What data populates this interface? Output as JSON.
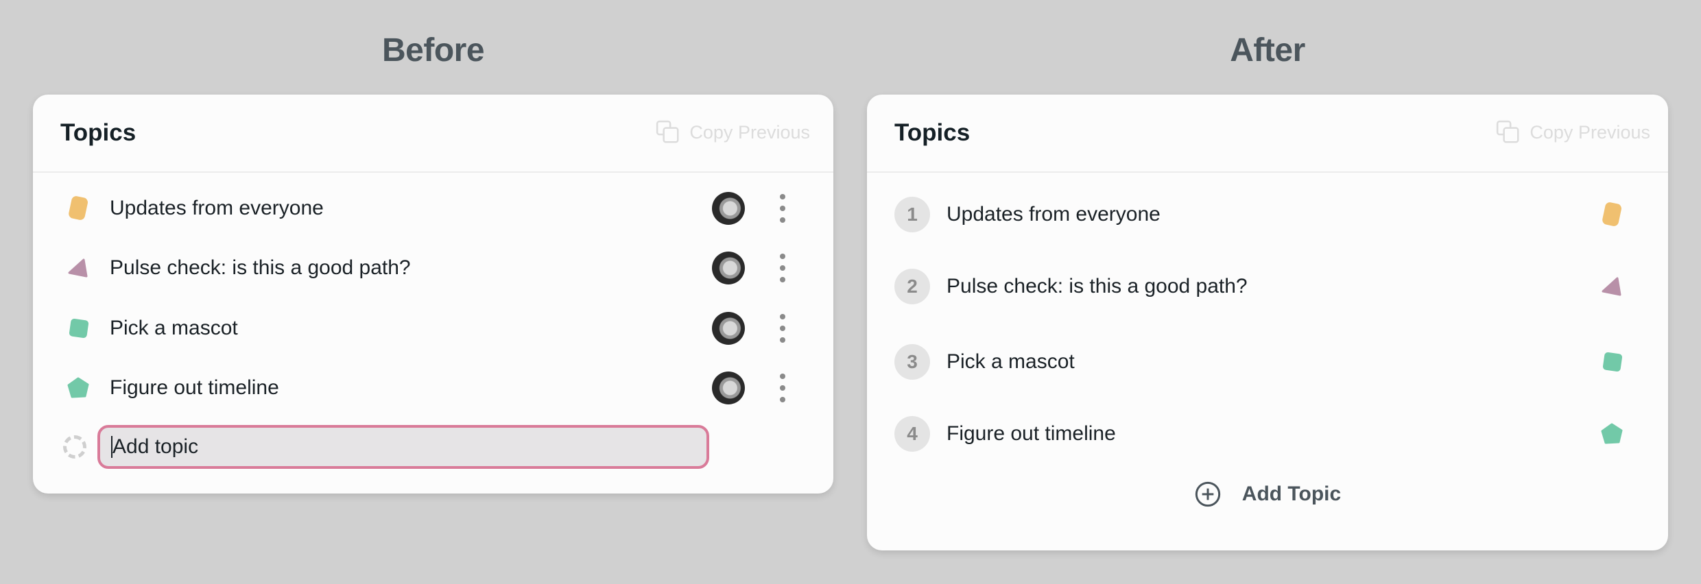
{
  "before": {
    "panel_title": "Before",
    "card": {
      "heading": "Topics",
      "copy_previous_label": "Copy Previous",
      "topics": [
        {
          "label": "Updates from everyone",
          "shape": "rounded-rectangle",
          "color": "#f0c070"
        },
        {
          "label": "Pulse check: is this a good path?",
          "shape": "triangle",
          "color": "#b890a8"
        },
        {
          "label": "Pick a mascot",
          "shape": "square",
          "color": "#72c9a8"
        },
        {
          "label": "Figure out timeline",
          "shape": "pentagon",
          "color": "#72c9a8"
        }
      ],
      "add_input": {
        "placeholder": "Add topic",
        "value": ""
      }
    }
  },
  "after": {
    "panel_title": "After",
    "card": {
      "heading": "Topics",
      "copy_previous_label": "Copy Previous",
      "topics": [
        {
          "number": "1",
          "label": "Updates from everyone",
          "shape": "rounded-rectangle",
          "color": "#f0c070"
        },
        {
          "number": "2",
          "label": "Pulse check: is this a good path?",
          "shape": "triangle",
          "color": "#b890a8"
        },
        {
          "number": "3",
          "label": "Pick a mascot",
          "shape": "square",
          "color": "#72c9a8"
        },
        {
          "number": "4",
          "label": "Figure out timeline",
          "shape": "pentagon",
          "color": "#72c9a8"
        }
      ],
      "add_topic_label": "Add Topic"
    }
  },
  "colors": {
    "input_focus_border": "#d97b99",
    "title_text": "#4b555c"
  }
}
